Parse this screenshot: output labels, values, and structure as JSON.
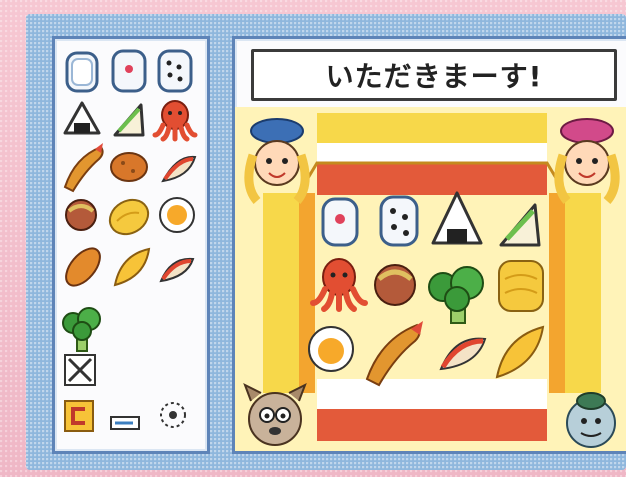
{
  "title": "いただきまーす!",
  "palette": {
    "items": [
      {
        "name": "sushi-roll-icon"
      },
      {
        "name": "sushi-roll-icon"
      },
      {
        "name": "nori-roll-icon"
      },
      {
        "name": "onigiri-icon"
      },
      {
        "name": "sandwich-icon"
      },
      {
        "name": "octopus-sausage-icon"
      },
      {
        "name": "fried-shrimp-icon"
      },
      {
        "name": "croquette-icon"
      },
      {
        "name": "apple-slice-icon"
      },
      {
        "name": "meatball-icon"
      },
      {
        "name": "tamagoyaki-icon"
      },
      {
        "name": "fried-egg-icon"
      },
      {
        "name": "sausage-icon"
      },
      {
        "name": "orange-slice-icon"
      },
      {
        "name": "apple-wedge-icon"
      },
      {
        "name": "broccoli-icon"
      }
    ],
    "tools": [
      {
        "name": "clear-icon"
      },
      {
        "name": "back-arrow-icon"
      },
      {
        "name": "pencil-icon"
      },
      {
        "name": "sparkle-icon"
      }
    ]
  },
  "colors": {
    "frame_pink": "#f3c3cf",
    "frame_blue": "#8fb7dd",
    "panel_border": "#5e84b8",
    "stage_yellow": "#f7d84a",
    "stage_red": "#e35a3a",
    "stage_cream": "#fff3b8"
  }
}
